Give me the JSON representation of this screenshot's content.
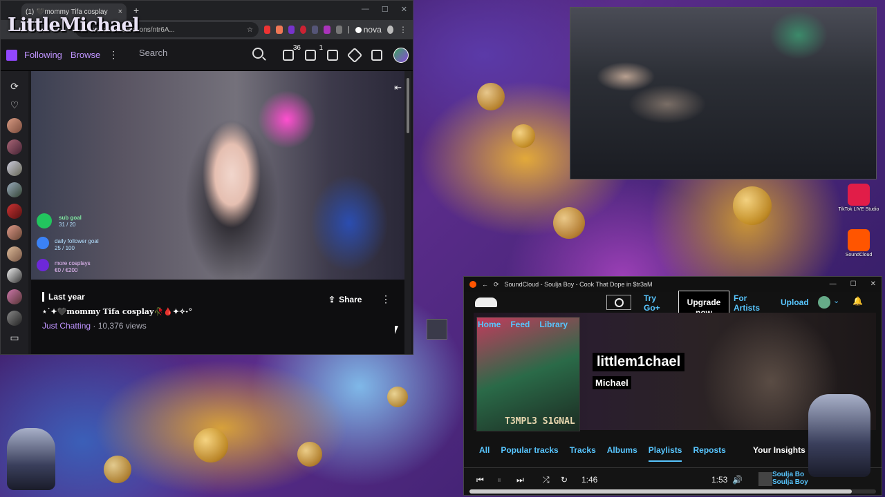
{
  "browser": {
    "tab_title": "(1) 🖤mommy Tifa cosplay",
    "tab_close": "×",
    "new_tab": "+",
    "url": "witch.tv/collections/ntr6A...",
    "nova_label": "nova",
    "overlay_logo": "LittleMichael",
    "win_min": "—",
    "win_max": "☐",
    "win_close": "✕"
  },
  "twitch": {
    "nav": {
      "following": "Following",
      "browse": "Browse",
      "more": "⋮",
      "search_placeholder": "Search",
      "inbox_count": "36",
      "notif_count": "1"
    },
    "goals": {
      "sub_goal_label": "sub goal",
      "sub_goal_value": "31 / 20",
      "follower_goal_label": "daily follower goal",
      "follower_goal_value": "25 / 100",
      "cosplay_goal_label": "more cosplays",
      "cosplay_goal_value": "€0 / €200"
    },
    "video_info": {
      "date": "Last year",
      "title": "⋆˙✦🖤mommy Tifa cosplay🥀🩸✦✧˖°",
      "category": "Just Chatting",
      "views": " · 10,376 views",
      "share": "Share",
      "more": "⋮"
    },
    "collapse_icon": "⇤"
  },
  "desktop": {
    "tiktok_label": "TikTok LIVE Studio",
    "soundcloud_label": "SoundCloud"
  },
  "soundcloud": {
    "window_title": "SoundCloud - Soulja Boy - Cook That Dope in $tr3aM",
    "nav": {
      "try_go": "Try Go+",
      "upgrade": "Upgrade now",
      "for_artists": "For Artists",
      "upload": "Upload",
      "home": "Home",
      "feed": "Feed",
      "library": "Library"
    },
    "profile": {
      "username": "littlem1chael",
      "real_name": "Michael",
      "cover_text": "T3MPL3 S1GNAL"
    },
    "tabs": [
      "All",
      "Popular tracks",
      "Tracks",
      "Albums",
      "Playlists",
      "Reposts"
    ],
    "active_tab": "Playlists",
    "insights": "Your Insights",
    "player": {
      "elapsed": "1:46",
      "duration": "1:53",
      "track_line1": "Soulja Bo",
      "track_line2": "Soulja Boy",
      "progress_fraction": 0.94
    }
  },
  "colors": {
    "twitch_purple": "#9147ff",
    "sc_orange": "#ff5500",
    "sc_link": "#58c6ff"
  }
}
